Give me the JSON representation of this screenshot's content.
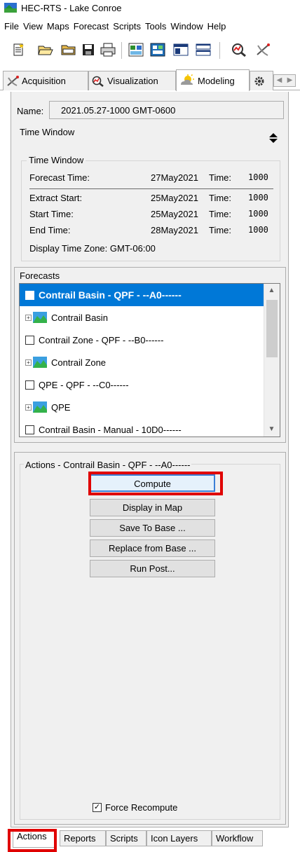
{
  "window": {
    "title": "HEC-RTS - Lake Conroe"
  },
  "menu": [
    "File",
    "View",
    "Maps",
    "Forecast",
    "Scripts",
    "Tools",
    "Window",
    "Help"
  ],
  "toolbar": {
    "icons": [
      "new-icon",
      "open-icon",
      "open-folder-icon",
      "save-icon",
      "print-icon",
      "refresh-icon",
      "compute-icon",
      "window-icon",
      "tile-icon",
      "visualization-icon",
      "acquisition-icon"
    ]
  },
  "top_tabs": [
    {
      "label": "Acquisition",
      "icon": "acquisition-icon"
    },
    {
      "label": "Visualization",
      "icon": "visualization-icon"
    },
    {
      "label": "Modeling",
      "icon": "modeling-icon",
      "active": true
    },
    {
      "label": "",
      "icon": "gear-icon"
    }
  ],
  "forecast_run": {
    "name_label": "Name:",
    "name_value": "2021.05.27-1000 GMT-0600",
    "time_window_header": "Time Window"
  },
  "time_window": {
    "legend": "Time Window",
    "rows": [
      {
        "label": "Forecast Time:",
        "date": "27May2021",
        "time_label": "Time:",
        "time": "1000"
      },
      {
        "label": "Extract Start:",
        "date": "25May2021",
        "time_label": "Time:",
        "time": "1000"
      },
      {
        "label": "Start Time:",
        "date": "25May2021",
        "time_label": "Time:",
        "time": "1000"
      },
      {
        "label": "End Time:",
        "date": "28May2021",
        "time_label": "Time:",
        "time": "1000"
      }
    ],
    "display_tz": "Display Time Zone:  GMT-06:00"
  },
  "forecasts": {
    "legend": "Forecasts",
    "items": [
      {
        "type": "alternative",
        "label": "Contrail Basin - QPF - --A0------",
        "selected": true
      },
      {
        "type": "tree",
        "label": "Contrail Basin"
      },
      {
        "type": "alternative",
        "label": "Contrail Zone - QPF - --B0------"
      },
      {
        "type": "tree",
        "label": "Contrail Zone"
      },
      {
        "type": "alternative",
        "label": "QPE - QPF - --C0------"
      },
      {
        "type": "tree",
        "label": "QPE"
      },
      {
        "type": "alternative",
        "label": "Contrail Basin - Manual - 10D0------"
      }
    ]
  },
  "actions": {
    "legend": "Actions - Contrail Basin - QPF - --A0------",
    "buttons": [
      "Compute",
      "Display in Map",
      "Save To Base ...",
      "Replace from Base ...",
      "Run Post..."
    ],
    "force_recompute_label": "Force Recompute",
    "force_recompute_checked": true,
    "highlight_color": "#e00000"
  },
  "bottom_tabs": [
    "Actions",
    "Reports",
    "Scripts",
    "Icon Layers",
    "Workflow"
  ],
  "colors": {
    "selection": "#0078d7",
    "panel": "#f0f0f0",
    "button": "#e1e1e1"
  }
}
